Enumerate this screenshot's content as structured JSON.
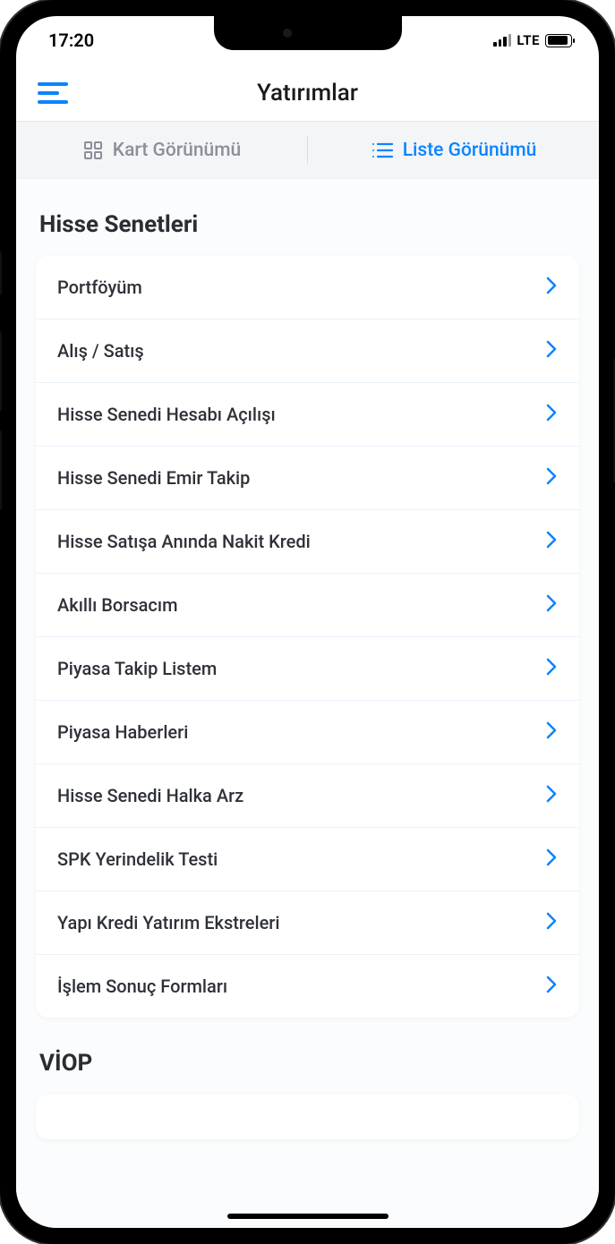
{
  "status_bar": {
    "time": "17:20",
    "network_label": "LTE"
  },
  "header": {
    "title": "Yatırımlar"
  },
  "view_toggle": {
    "card_label": "Kart Görünümü",
    "list_label": "Liste Görünümü"
  },
  "sections": {
    "hisse": {
      "title": "Hisse Senetleri",
      "items": [
        {
          "label": "Portföyüm"
        },
        {
          "label": "Alış / Satış"
        },
        {
          "label": "Hisse Senedi Hesabı Açılışı"
        },
        {
          "label": "Hisse Senedi Emir Takip"
        },
        {
          "label": "Hisse Satışa Anında Nakit Kredi"
        },
        {
          "label": "Akıllı Borsacım"
        },
        {
          "label": "Piyasa Takip Listem"
        },
        {
          "label": "Piyasa Haberleri"
        },
        {
          "label": "Hisse Senedi Halka Arz"
        },
        {
          "label": "SPK Yerindelik Testi"
        },
        {
          "label": "Yapı Kredi Yatırım Ekstreleri"
        },
        {
          "label": "İşlem Sonuç Formları"
        }
      ]
    },
    "viop": {
      "title": "VİOP"
    }
  },
  "colors": {
    "accent": "#0a84ff"
  }
}
